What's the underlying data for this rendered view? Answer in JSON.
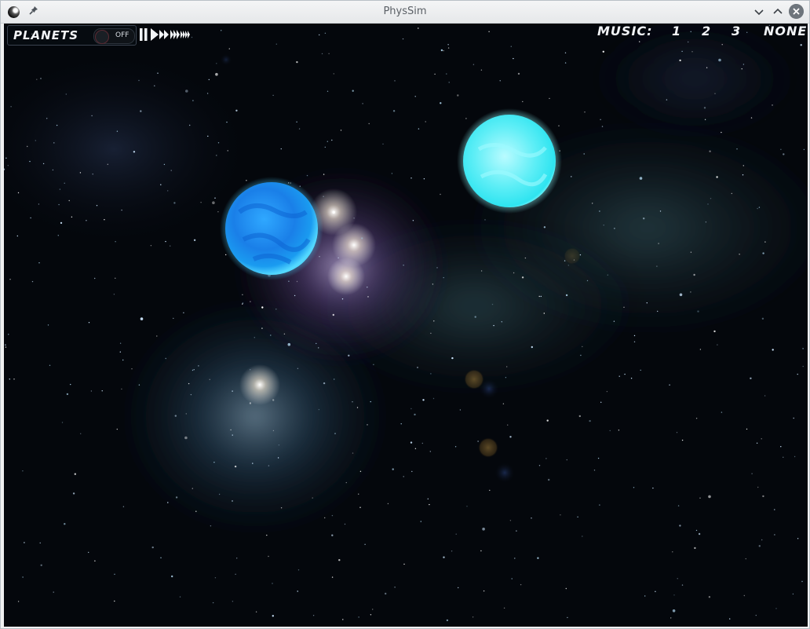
{
  "window": {
    "title": "PhysSim"
  },
  "hud": {
    "planets_label": "PLANETS",
    "planets_toggle": {
      "state_text": "OFF"
    },
    "speed_controls": [
      "pause",
      "play",
      "fast-forward-2x",
      "fast-forward-3x",
      "fast-forward-4x"
    ],
    "music": {
      "label": "MUSIC:",
      "options": [
        "1",
        "2",
        "3",
        "NONE"
      ]
    }
  },
  "colors": {
    "space": "#04070c",
    "planet_blue": "#1a8cff",
    "planet_cyan": "#3ff0f5",
    "hud_text": "#f2f4f7"
  }
}
